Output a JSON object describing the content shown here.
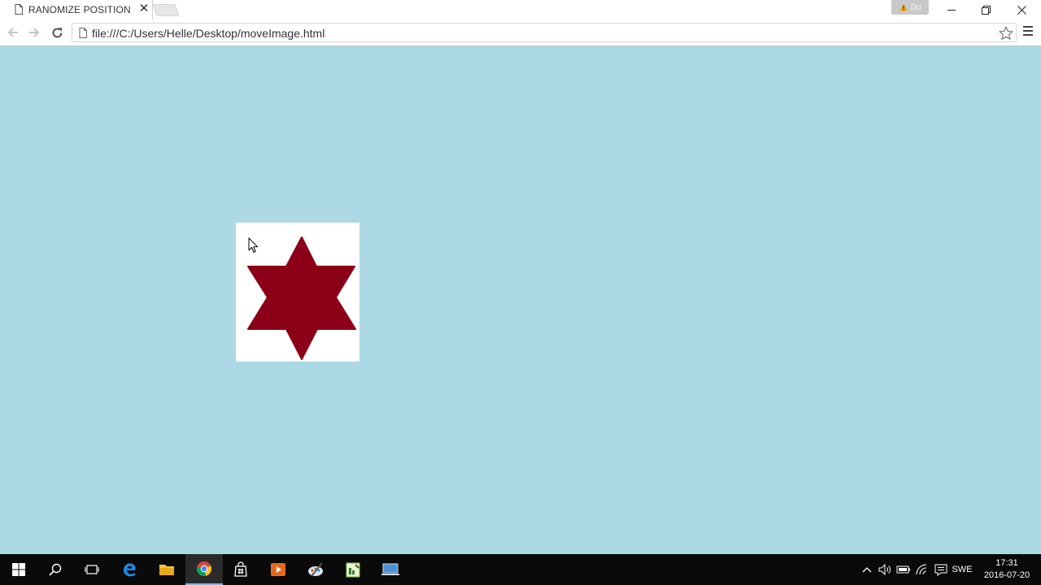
{
  "browser": {
    "tab": {
      "title": "RANOMIZE POSITION",
      "close_glyph": "✕"
    },
    "profile": {
      "name": "Du",
      "warning_icon": "warning-icon",
      "bg_color": "#c8c8c8"
    },
    "window_controls": {
      "minimize_icon": "minimize-icon",
      "restore_icon": "restore-icon",
      "close_icon": "close-icon"
    },
    "toolbar": {
      "back_icon": "back-arrow-icon",
      "forward_icon": "forward-arrow-icon",
      "reload_icon": "reload-icon",
      "url": "file:///C:/Users/Helle/Desktop/moveImage.html",
      "bookmark_icon": "star-outline-icon",
      "menu_icon": "hamburger-menu-icon"
    }
  },
  "page": {
    "background_color": "#add8e6",
    "image": {
      "description_icon": "six-pointed-star-icon",
      "star_color": "#8b0016",
      "frame_color": "#ffffff"
    }
  },
  "taskbar": {
    "icons": [
      "windows-start-icon",
      "search-icon",
      "task-view-icon",
      "edge-icon",
      "file-explorer-icon",
      "chrome-icon",
      "store-icon",
      "media-player-icon",
      "paint-icon",
      "notepad-plus-icon",
      "remote-desktop-icon"
    ],
    "active_icon": "chrome-icon",
    "tray": {
      "icons": [
        "chevron-up-icon",
        "volume-icon",
        "battery-icon",
        "wifi-icon",
        "action-center-icon"
      ],
      "language": "SWE",
      "time": "17:31",
      "date": "2016-07-20"
    }
  }
}
